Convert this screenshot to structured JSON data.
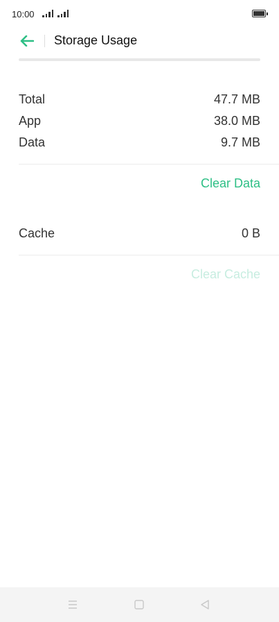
{
  "status_bar": {
    "time": "10:00"
  },
  "header": {
    "title": "Storage Usage",
    "back_icon": "arrow-left-icon"
  },
  "storage": {
    "rows": [
      {
        "label": "Total",
        "value": "47.7 MB"
      },
      {
        "label": "App",
        "value": "38.0 MB"
      },
      {
        "label": "Data",
        "value": "9.7 MB"
      }
    ],
    "clear_data_label": "Clear Data"
  },
  "cache": {
    "label": "Cache",
    "value": "0 B",
    "clear_cache_label": "Clear Cache"
  },
  "colors": {
    "accent": "#2dbf85",
    "accent_disabled": "#c7ede0"
  }
}
